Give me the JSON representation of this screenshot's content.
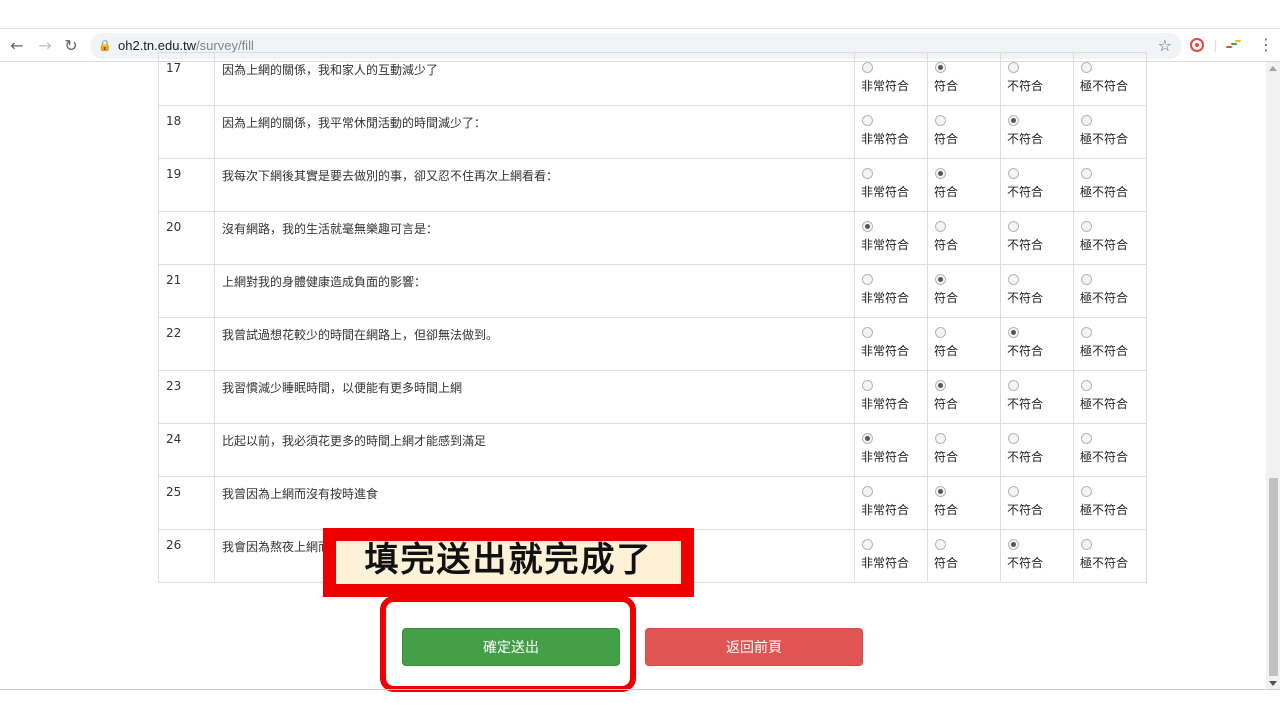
{
  "browser": {
    "url_host": "oh2.tn.edu.tw",
    "url_path": "/survey/fill"
  },
  "icons": {
    "back": "arrow-left-icon",
    "forward": "arrow-right-icon",
    "reload": "reload-icon",
    "lock": "lock-icon",
    "bookmark": "star-icon",
    "menu": "kebab-menu-icon"
  },
  "survey": {
    "option_labels": [
      "非常符合",
      "符合",
      "不符合",
      "極不符合"
    ],
    "rows": [
      {
        "num": "17",
        "question": "因為上網的關係，我和家人的互動減少了",
        "selected": 1
      },
      {
        "num": "18",
        "question": "因為上網的關係，我平常休閒活動的時間減少了：",
        "selected": 2
      },
      {
        "num": "19",
        "question": "我每次下網後其實是要去做別的事，卻又忍不住再次上網看看：",
        "selected": 1
      },
      {
        "num": "20",
        "question": "沒有網路，我的生活就毫無樂趣可言是：",
        "selected": 0
      },
      {
        "num": "21",
        "question": "上網對我的身體健康造成負面的影響：",
        "selected": 1
      },
      {
        "num": "22",
        "question": "我曾試過想花較少的時間在網路上，但卻無法做到。",
        "selected": 2
      },
      {
        "num": "23",
        "question": "我習慣減少睡眠時間，以便能有更多時間上網",
        "selected": 1
      },
      {
        "num": "24",
        "question": "比起以前，我必須花更多的時間上網才能感到滿足",
        "selected": 0
      },
      {
        "num": "25",
        "question": "我曾因為上網而沒有按時進食",
        "selected": 1
      },
      {
        "num": "26",
        "question": "我會因為熬夜上網而",
        "selected": 2
      }
    ]
  },
  "buttons": {
    "submit": "確定送出",
    "back": "返回前頁"
  },
  "annotation": {
    "callout_text": "填完送出就完成了"
  },
  "colors": {
    "submit_green": "#43a047",
    "back_red": "#e05552",
    "annotation_red": "#ee0000",
    "callout_bg": "#fdf1d8"
  }
}
